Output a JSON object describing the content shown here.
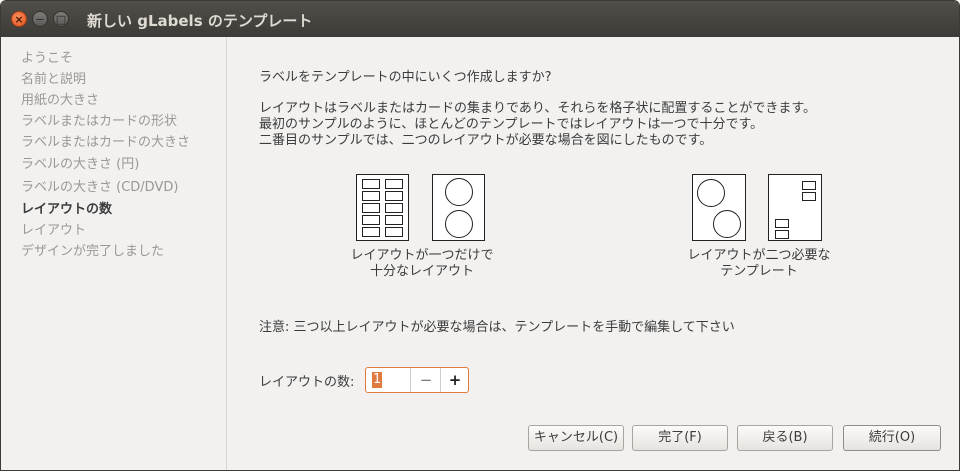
{
  "window": {
    "title": "新しい gLabels のテンプレート"
  },
  "sidebar": {
    "steps": [
      "ようこそ",
      "名前と説明",
      "用紙の大きさ",
      "ラベルまたはカードの形状",
      "ラベルまたはカードの大きさ",
      "ラベルの大きさ (円)",
      "ラベルの大きさ (CD/DVD)",
      "レイアウトの数",
      "レイアウト",
      "デザインが完了しました"
    ]
  },
  "main": {
    "question": "ラベルをテンプレートの中にいくつ作成しますか?",
    "description": [
      "レイアウトはラベルまたはカードの集まりであり、それらを格子状に配置することができます。",
      "最初のサンプルのように、ほとんどのテンプレートではレイアウトは一つで十分です。",
      "二番目のサンプルでは、二つのレイアウトが必要な場合を図にしたものです。"
    ],
    "caption_one": [
      "レイアウトが一つだけで",
      "十分なレイアウト"
    ],
    "caption_two": [
      "レイアウトが二つ必要な",
      "テンプレート"
    ],
    "note": "注意: 三つ以上レイアウトが必要な場合は、テンプレートを手動で編集して下さい",
    "count_label": "レイアウトの数:",
    "count_value": "1",
    "minus": "−",
    "plus": "+"
  },
  "buttons": {
    "cancel": "キャンセル(C)",
    "finish": "完了(F)",
    "back": "戻る(B)",
    "next": "続行(O)"
  }
}
